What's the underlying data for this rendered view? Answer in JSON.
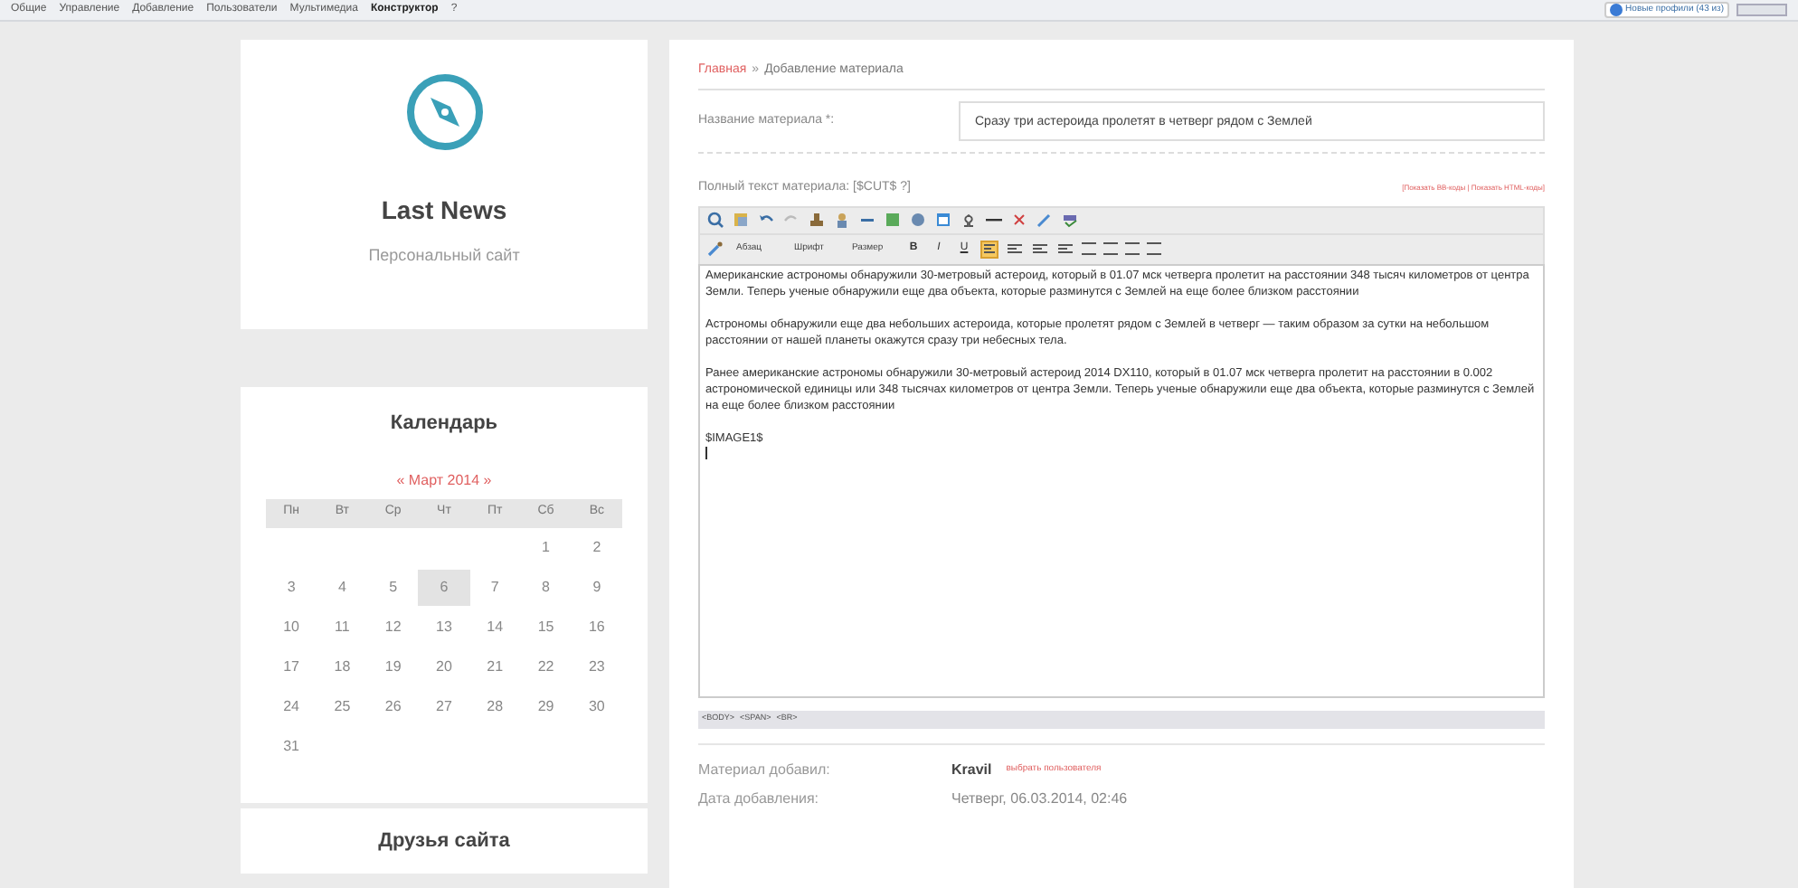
{
  "top_menu": {
    "items": [
      {
        "label": "Общие",
        "bold": false
      },
      {
        "label": "Управление",
        "bold": false
      },
      {
        "label": "Добавление",
        "bold": false
      },
      {
        "label": "Пользователи",
        "bold": false
      },
      {
        "label": "Мультимедиа",
        "bold": false
      },
      {
        "label": "Конструктор",
        "bold": true
      },
      {
        "label": "?",
        "bold": false
      }
    ],
    "notice": "Новые профили (43 из)"
  },
  "site_card": {
    "title": "Last News",
    "subtitle": "Персональный сайт"
  },
  "calendar": {
    "title": "Календарь",
    "month": "« Март 2014 »",
    "weekdays": [
      "Пн",
      "Вт",
      "Ср",
      "Чт",
      "Пт",
      "Сб",
      "Вс"
    ],
    "weeks": [
      {
        "right_aligned": true,
        "days": [
          {
            "day": "1",
            "selected": false
          },
          {
            "day": "2",
            "selected": false
          }
        ]
      },
      {
        "days": [
          {
            "day": "3",
            "selected": false
          },
          {
            "day": "4",
            "selected": false
          },
          {
            "day": "5",
            "selected": false
          },
          {
            "day": "6",
            "selected": true
          },
          {
            "day": "7",
            "selected": false
          },
          {
            "day": "8",
            "selected": false
          },
          {
            "day": "9",
            "selected": false
          }
        ]
      },
      {
        "days": [
          {
            "day": "10",
            "selected": false
          },
          {
            "day": "11",
            "selected": false
          },
          {
            "day": "12",
            "selected": false
          },
          {
            "day": "13",
            "selected": false
          },
          {
            "day": "14",
            "selected": false
          },
          {
            "day": "15",
            "selected": false
          },
          {
            "day": "16",
            "selected": false
          }
        ]
      },
      {
        "days": [
          {
            "day": "17",
            "selected": false
          },
          {
            "day": "18",
            "selected": false
          },
          {
            "day": "19",
            "selected": false
          },
          {
            "day": "20",
            "selected": false
          },
          {
            "day": "21",
            "selected": false
          },
          {
            "day": "22",
            "selected": false
          },
          {
            "day": "23",
            "selected": false
          }
        ]
      },
      {
        "days": [
          {
            "day": "24",
            "selected": false
          },
          {
            "day": "25",
            "selected": false
          },
          {
            "day": "26",
            "selected": false
          },
          {
            "day": "27",
            "selected": false
          },
          {
            "day": "28",
            "selected": false
          },
          {
            "day": "29",
            "selected": false
          },
          {
            "day": "30",
            "selected": false
          }
        ]
      },
      {
        "right_aligned": false,
        "days": [
          {
            "day": "31",
            "selected": false
          }
        ]
      }
    ]
  },
  "friends": {
    "title": "Друзья сайта"
  },
  "breadcrumb": {
    "home": "Главная",
    "separator": "»",
    "current": "Добавление материала"
  },
  "title_field": {
    "label": "Название материала *:",
    "value": "Сразу три астероида пролетят в четверг рядом с Землей"
  },
  "editor": {
    "label": "Полный текст материала: [$CUT$ ?]",
    "mode_links": "[Показать BB-коды | Показать HTML-коды]",
    "dropdowns": [
      "Абзац",
      "Шрифт",
      "Размер"
    ],
    "format_buttons": [
      {
        "label": "B",
        "selected": false
      },
      {
        "label": "I",
        "selected": false
      },
      {
        "label": "U",
        "selected": false
      }
    ],
    "align_buttons": [
      {
        "selected": true
      },
      {
        "selected": false
      },
      {
        "selected": false
      },
      {
        "selected": false
      }
    ],
    "paragraphs": [
      "Американские астрономы обнаружили 30-метровый астероид, который в 01.07 мск четверга пролетит на расстоянии 348 тысяч километров от центра Земли. Теперь ученые обнаружили еще два объекта, которые разминутся с Землей на еще более близком расстоянии",
      "Астрономы обнаружили еще два небольших астероида, которые пролетят рядом с Землей в четверг — таким образом за сутки на небольшом расстоянии от нашей планеты окажутся сразу три небесных тела.",
      "Ранее американские астрономы обнаружили 30-метровый астероид 2014 DX110, который в 01.07 мск четверга пролетит на расстоянии в 0.002 астрономической единицы или 348 тысячах километров от центра Земли. Теперь ученые обнаружили еще два объекта, которые разминутся с Землей на еще более близком расстоянии",
      "$IMAGE1$"
    ],
    "path": [
      "<BODY>",
      "<SPAN>",
      "<BR>"
    ]
  },
  "meta": [
    {
      "label": "Материал добавил:",
      "value": "Kravil",
      "link": "выбрать пользователя"
    },
    {
      "label": "Дата добавления:",
      "value": "Четверг, 06.03.2014, 02:46"
    }
  ]
}
